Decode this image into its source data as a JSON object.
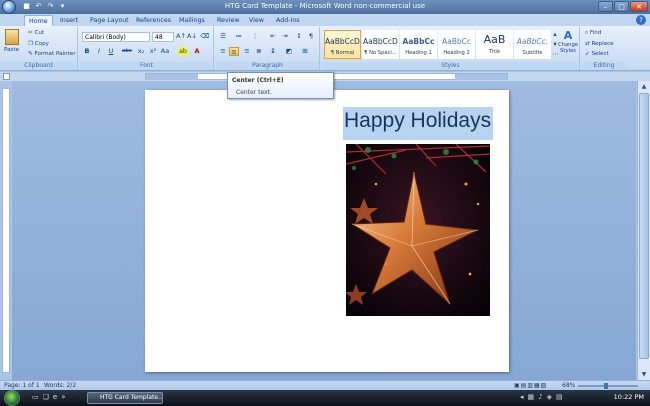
{
  "window": {
    "title": "HTG Card Template - Microsoft Word non-commercial use",
    "controls": [
      "minimize-icon",
      "maximize-icon",
      "close-icon"
    ]
  },
  "quick_access": [
    "save-icon",
    "undo-icon",
    "redo-icon",
    "customize-icon"
  ],
  "tabs": [
    "Home",
    "Insert",
    "Page Layout",
    "References",
    "Mailings",
    "Review",
    "View",
    "Add-Ins"
  ],
  "clipboard": {
    "paste": "Paste",
    "cut": "Cut",
    "copy": "Copy",
    "format_painter": "Format Painter",
    "label": "Clipboard"
  },
  "font": {
    "name": "Calibri (Body)",
    "size": "48",
    "label": "Font",
    "buttons": [
      "B",
      "I",
      "U",
      "abc",
      "x₂",
      "x²",
      "Aa"
    ]
  },
  "paragraph": {
    "label": "Paragraph",
    "selected": "Center"
  },
  "styles": {
    "label": "Styles",
    "items": [
      {
        "preview": "AaBbCcDc",
        "name": "¶ Normal"
      },
      {
        "preview": "AaBbCcDc",
        "name": "¶ No Spaci..."
      },
      {
        "preview": "AaBbCc",
        "name": "Heading 1"
      },
      {
        "preview": "AaBbCc",
        "name": "Heading 2"
      },
      {
        "preview": "AaB",
        "name": "Title"
      },
      {
        "preview": "AaBbCc.",
        "name": "Subtitle"
      }
    ],
    "change_styles": "Change Styles"
  },
  "editing": {
    "find": "Find",
    "replace": "Replace",
    "select": "Select",
    "label": "Editing"
  },
  "tooltip": {
    "title": "Center (Ctrl+E)",
    "description": "Center text."
  },
  "document": {
    "heading": "Happy Holidays"
  },
  "status": {
    "page": "Page: 1 of 1",
    "words": "Words: 2/2",
    "zoom": "68%"
  },
  "taskbar": {
    "app_item": "HTG Card Template...",
    "time": "10:22 PM"
  }
}
